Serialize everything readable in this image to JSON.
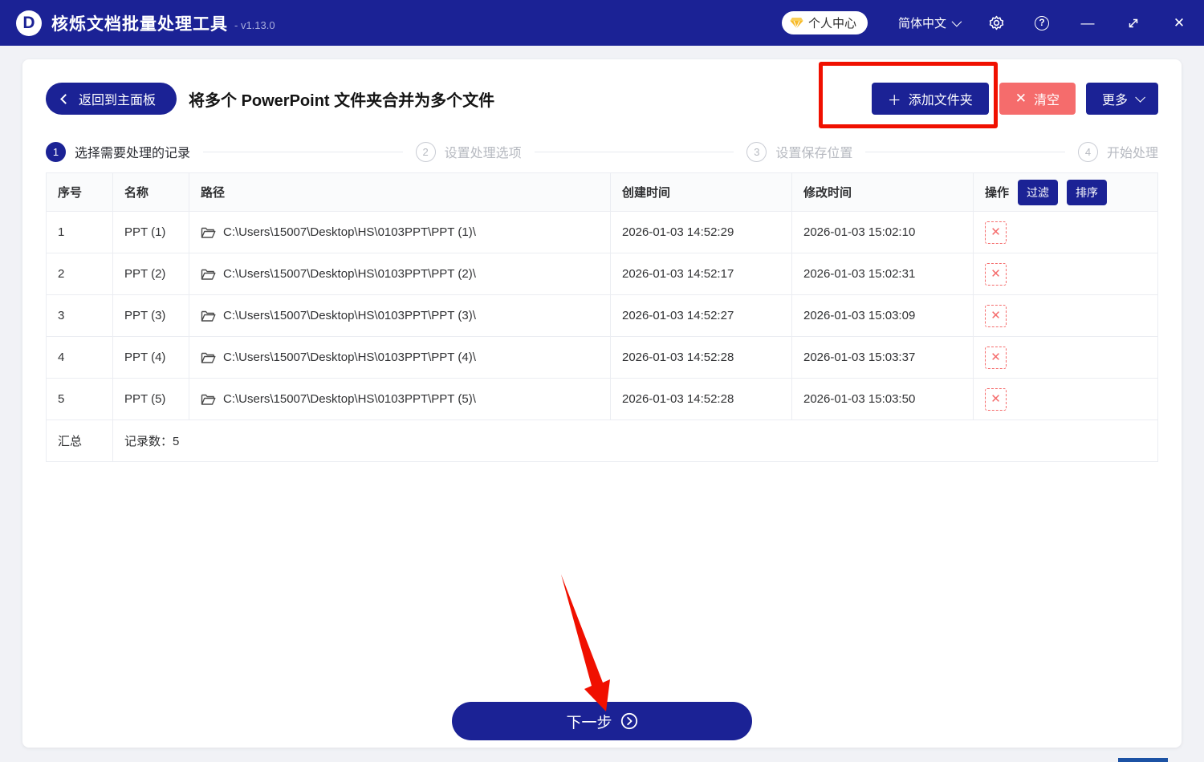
{
  "titlebar": {
    "logo_letter": "D",
    "app_title": "核烁文档批量处理工具",
    "version": "- v1.13.0",
    "user_center_label": "个人中心",
    "language_label": "简体中文",
    "minimize_glyph": "—",
    "close_glyph": "✕",
    "help_glyph": "?"
  },
  "header": {
    "back_label": "返回到主面板",
    "page_title": "将多个 PowerPoint 文件夹合并为多个文件",
    "add_folder_label": "添加文件夹",
    "add_folder_plus": "＋",
    "clear_label": "清空",
    "clear_x": "✕",
    "more_label": "更多"
  },
  "steps": [
    {
      "num": "1",
      "label": "选择需要处理的记录"
    },
    {
      "num": "2",
      "label": "设置处理选项"
    },
    {
      "num": "3",
      "label": "设置保存位置"
    },
    {
      "num": "4",
      "label": "开始处理"
    }
  ],
  "table": {
    "columns": {
      "index": "序号",
      "name": "名称",
      "path": "路径",
      "created": "创建时间",
      "modified": "修改时间",
      "action": "操作"
    },
    "filter_label": "过滤",
    "sort_label": "排序",
    "delete_glyph": "✕",
    "rows": [
      {
        "index": "1",
        "name": "PPT (1)",
        "path": "C:\\Users\\15007\\Desktop\\HS\\0103PPT\\PPT (1)\\",
        "created": "2026-01-03 14:52:29",
        "modified": "2026-01-03 15:02:10"
      },
      {
        "index": "2",
        "name": "PPT (2)",
        "path": "C:\\Users\\15007\\Desktop\\HS\\0103PPT\\PPT (2)\\",
        "created": "2026-01-03 14:52:17",
        "modified": "2026-01-03 15:02:31"
      },
      {
        "index": "3",
        "name": "PPT (3)",
        "path": "C:\\Users\\15007\\Desktop\\HS\\0103PPT\\PPT (3)\\",
        "created": "2026-01-03 14:52:27",
        "modified": "2026-01-03 15:03:09"
      },
      {
        "index": "4",
        "name": "PPT (4)",
        "path": "C:\\Users\\15007\\Desktop\\HS\\0103PPT\\PPT (4)\\",
        "created": "2026-01-03 14:52:28",
        "modified": "2026-01-03 15:03:37"
      },
      {
        "index": "5",
        "name": "PPT (5)",
        "path": "C:\\Users\\15007\\Desktop\\HS\\0103PPT\\PPT (5)\\",
        "created": "2026-01-03 14:52:28",
        "modified": "2026-01-03 15:03:50"
      }
    ],
    "summary_label": "汇总",
    "summary_value": "记录数：5"
  },
  "footer": {
    "next_label": "下一步"
  },
  "colors": {
    "primary_blue": "#1B2295",
    "danger_red": "#F56C6C",
    "annotation_red": "#F01000"
  }
}
